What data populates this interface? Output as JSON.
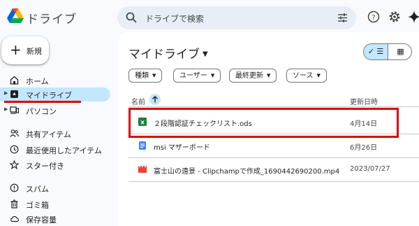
{
  "app": {
    "title": "ドライブ"
  },
  "search": {
    "placeholder": "ドライブで検索"
  },
  "sidebar": {
    "new_label": "新規",
    "items": [
      {
        "label": "ホーム",
        "icon": "home-icon"
      },
      {
        "label": "マイドライブ",
        "icon": "drive-icon",
        "active": true
      },
      {
        "label": "パソコン",
        "icon": "computer-icon"
      },
      {
        "label": "共有アイテム",
        "icon": "people-icon"
      },
      {
        "label": "最近使用したアイテム",
        "icon": "clock-icon"
      },
      {
        "label": "スター付き",
        "icon": "star-icon"
      },
      {
        "label": "スパム",
        "icon": "spam-icon"
      },
      {
        "label": "ゴミ箱",
        "icon": "trash-icon"
      },
      {
        "label": "保存容量",
        "icon": "cloud-icon"
      }
    ]
  },
  "main": {
    "title": "マイドライブ",
    "view_list": "✓ ☰",
    "view_grid": "▦",
    "filters": [
      "種類",
      "ユーザー",
      "最終更新",
      "ソース"
    ],
    "columns": {
      "name": "名前",
      "modified": "更新日時"
    },
    "files": [
      {
        "name": "２段階認証チェックリスト.ods",
        "modified": "4月14日",
        "icon": "spreadsheet-icon",
        "color": "#188038"
      },
      {
        "name": "msi マザーボード",
        "modified": "6月26日",
        "icon": "document-icon",
        "color": "#4285f4"
      },
      {
        "name": "富士山の遠景 - Clipchampで作成_1690442690200.mp4",
        "modified": "2023/07/27",
        "icon": "video-icon",
        "color": "#ea4335"
      }
    ]
  },
  "colors": {
    "accent": "#c2e7ff",
    "highlight": "#e00000",
    "search_bg": "#e9eef6"
  }
}
